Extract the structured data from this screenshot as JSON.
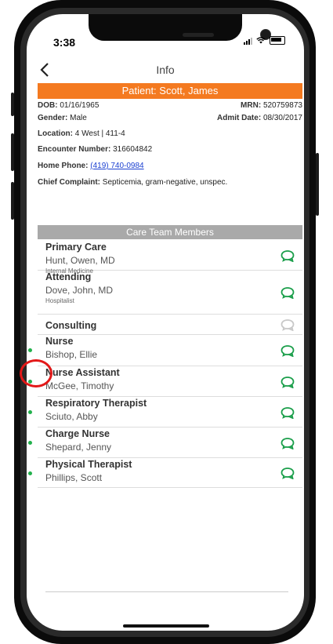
{
  "status": {
    "time": "3:38"
  },
  "nav": {
    "title": "Info"
  },
  "patient": {
    "banner": "Patient: Scott, James",
    "dob_label": "DOB:",
    "dob": "01/16/1965",
    "mrn_label": "MRN:",
    "mrn": "520759873",
    "gender_label": "Gender:",
    "gender": "Male",
    "admit_label": "Admit Date:",
    "admit": "08/30/2017",
    "location_label": "Location:",
    "location": "4 West | 411-4",
    "encounter_label": "Encounter Number:",
    "encounter": "316604842",
    "phone_label": "Home Phone:",
    "phone": "(419) 740-0984",
    "complaint_label": "Chief Complaint:",
    "complaint": "Septicemia, gram-negative, unspec."
  },
  "care_team": {
    "header": "Care Team Members",
    "items": [
      {
        "role": "Primary Care",
        "name": "Hunt, Owen, MD",
        "specialty": "Internal Medicine",
        "chat": "active",
        "online": false
      },
      {
        "role": "Attending",
        "name": "Dove, John, MD",
        "specialty": "Hospitalist",
        "chat": "active",
        "online": false
      },
      {
        "role": "Consulting",
        "name": "",
        "specialty": "",
        "chat": "inactive",
        "online": false
      },
      {
        "role": "Nurse",
        "name": "Bishop, Ellie",
        "specialty": "",
        "chat": "active",
        "online": true
      },
      {
        "role": "Nurse Assistant",
        "name": "McGee, Timothy",
        "specialty": "",
        "chat": "active",
        "online": true
      },
      {
        "role": "Respiratory Therapist",
        "name": "Sciuto, Abby",
        "specialty": "",
        "chat": "active",
        "online": true
      },
      {
        "role": "Charge Nurse",
        "name": "Shepard, Jenny",
        "specialty": "",
        "chat": "active",
        "online": true
      },
      {
        "role": "Physical Therapist",
        "name": "Phillips, Scott",
        "specialty": "",
        "chat": "active",
        "online": true
      }
    ]
  },
  "colors": {
    "accent": "#f47a20",
    "chat_active": "#1a9e4a",
    "chat_inactive": "#c8c8c8",
    "presence": "#22b14c",
    "highlight": "#e31818"
  }
}
